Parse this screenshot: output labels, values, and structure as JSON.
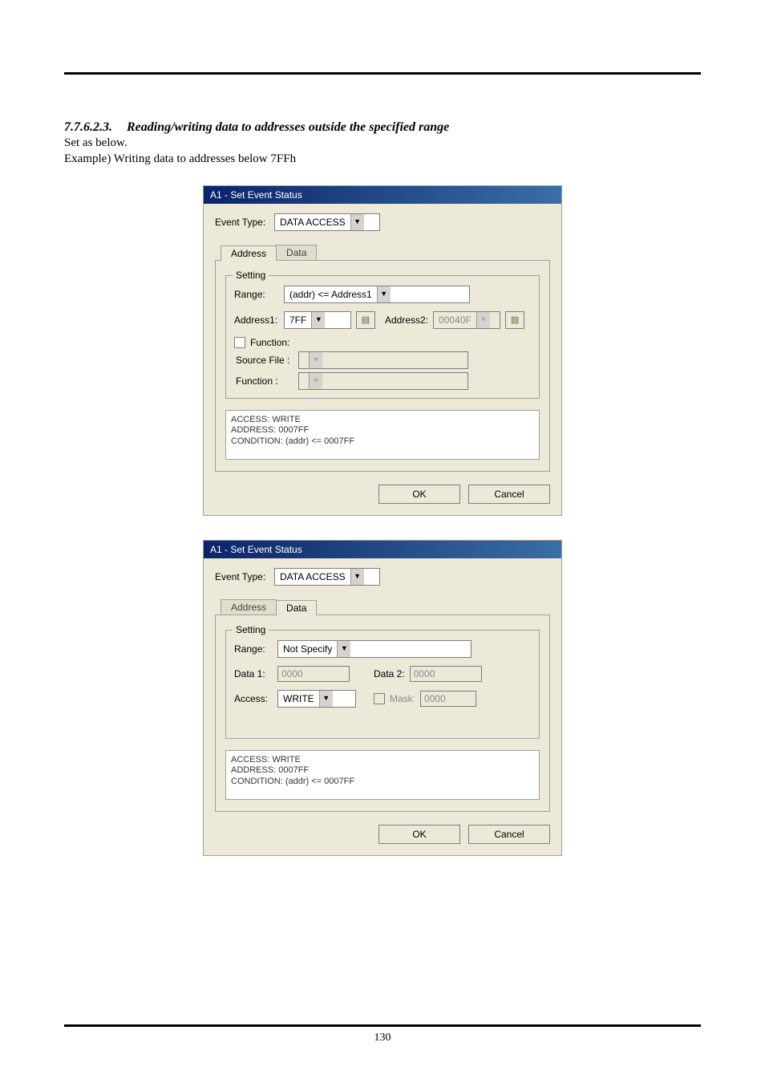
{
  "page_number": "130",
  "heading_number": "7.7.6.2.3.",
  "heading_text": "Reading/writing data to addresses outside the specified range",
  "body_line1": "Set as below.",
  "body_line2": "Example) Writing data to addresses below 7FFh",
  "dlg": {
    "title": "A1 - Set Event Status",
    "event_type_label": "Event Type:",
    "event_type_value": "DATA ACCESS",
    "tab_address": "Address",
    "tab_data": "Data",
    "group_title": "Setting",
    "range_label": "Range:",
    "addr1_label": "Address1:",
    "addr2_label": "Address2:",
    "func_chk": "Function:",
    "src_label": "Source File :",
    "func_label": "Function :",
    "ok": "OK",
    "cancel": "Cancel"
  },
  "dlg1": {
    "range_value": "(addr) <= Address1",
    "addr1_value": "7FF",
    "addr2_value": "00040F",
    "summary": "ACCESS: WRITE\nADDRESS: 0007FF\nCONDITION: (addr) <= 0007FF"
  },
  "dlg2": {
    "range_label": "Range:",
    "range_value": "Not Specify",
    "data1_label": "Data 1:",
    "data1_value": "0000",
    "data2_label": "Data 2:",
    "data2_value": "0000",
    "access_label": "Access:",
    "access_value": "WRITE",
    "mask_label": "Mask:",
    "mask_value": "0000",
    "summary": "ACCESS: WRITE\nADDRESS: 0007FF\nCONDITION: (addr) <= 0007FF"
  }
}
